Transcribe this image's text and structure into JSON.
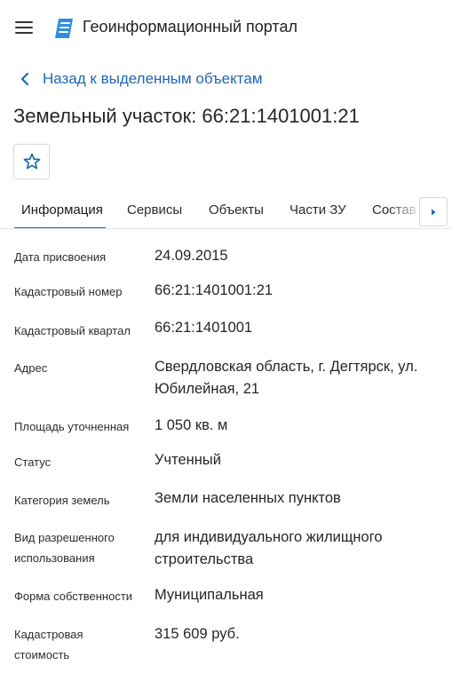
{
  "header": {
    "app_title": "Геоинформационный портал"
  },
  "back_link": {
    "label": "Назад к выделенным объектам"
  },
  "page_title": "Земельный участок: 66:21:1401001:21",
  "tabs": [
    {
      "label": "Информация",
      "active": true
    },
    {
      "label": "Сервисы",
      "active": false
    },
    {
      "label": "Объекты",
      "active": false
    },
    {
      "label": "Части ЗУ",
      "active": false
    },
    {
      "label": "Состав",
      "active": false
    }
  ],
  "colors": {
    "accent": "#1f67b3",
    "logo": "#2f8ce0"
  },
  "icons": {
    "menu": "menu-icon",
    "logo": "portal-logo-icon",
    "back": "chevron-left-icon",
    "favorite": "star-icon",
    "tabs_next": "caret-right-icon"
  },
  "fields": [
    {
      "label": "Дата присвоения",
      "value": "24.09.2015"
    },
    {
      "label": "Кадастровый номер",
      "value": "66:21:1401001:21"
    },
    {
      "label": "Кадастровый квартал",
      "value": "66:21:1401001"
    },
    {
      "label": "Адрес",
      "value": "Свердловская область, г. Дегтярск, ул. Юбилейная, 21"
    },
    {
      "label": "Площадь уточненная",
      "value": "1 050 кв. м"
    },
    {
      "label": "Статус",
      "value": "Учтенный"
    },
    {
      "label": "Категория земель",
      "value": "Земли населенных пунктов"
    },
    {
      "label": "Вид разрешенного использования",
      "value": "для индивидуального жилищного строительства"
    },
    {
      "label": "Форма собственности",
      "value": "Муниципальная"
    },
    {
      "label": "Кадастровая стоимость",
      "value": "315 609 руб."
    }
  ]
}
